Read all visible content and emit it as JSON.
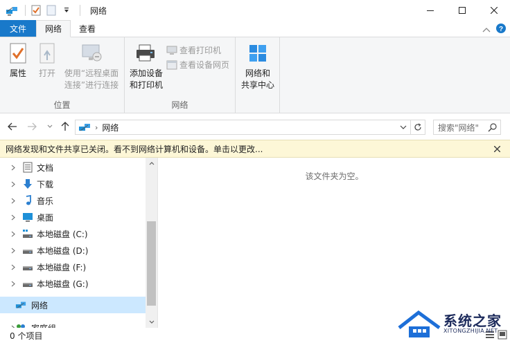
{
  "window": {
    "title": "网络"
  },
  "tabs": {
    "file": "文件",
    "network": "网络",
    "view": "查看"
  },
  "ribbon": {
    "location_group": {
      "label": "位置",
      "properties": "属性",
      "open": "打开",
      "remote_line1": "使用“远程桌面",
      "remote_line2": "连接”进行连接"
    },
    "network_group": {
      "label": "网络",
      "add_device_line1": "添加设备",
      "add_device_line2": "和打印机",
      "view_printer": "查看打印机",
      "view_device_page": "查看设备网页",
      "center_line1": "网络和",
      "center_line2": "共享中心"
    }
  },
  "address": {
    "location": "网络",
    "search_placeholder": "搜索\"网络\""
  },
  "infobar": {
    "message": "网络发现和文件共享已关闭。看不到网络计算机和设备。单击以更改..."
  },
  "navpane": {
    "items": [
      {
        "label": "文档",
        "icon": "document-icon"
      },
      {
        "label": "下载",
        "icon": "download-icon"
      },
      {
        "label": "音乐",
        "icon": "music-icon"
      },
      {
        "label": "桌面",
        "icon": "desktop-icon"
      },
      {
        "label": "本地磁盘 (C:)",
        "icon": "system-drive-icon"
      },
      {
        "label": "本地磁盘 (D:)",
        "icon": "drive-icon"
      },
      {
        "label": "本地磁盘 (F:)",
        "icon": "drive-icon"
      },
      {
        "label": "本地磁盘 (G:)",
        "icon": "drive-icon"
      }
    ],
    "network": "网络",
    "homegroup": "家庭组"
  },
  "content": {
    "empty_message": "该文件夹为空。"
  },
  "status": {
    "item_count": "0 个项目"
  },
  "watermark": {
    "brand": "系统之家",
    "url": "XITONGZHIJIA.NET"
  },
  "colors": {
    "file_tab": "#1979ca",
    "selection": "#cce8ff",
    "infobar_bg": "#fdf7d7",
    "ribbon_bg": "#f5f6f7",
    "help": "#1979ca"
  }
}
